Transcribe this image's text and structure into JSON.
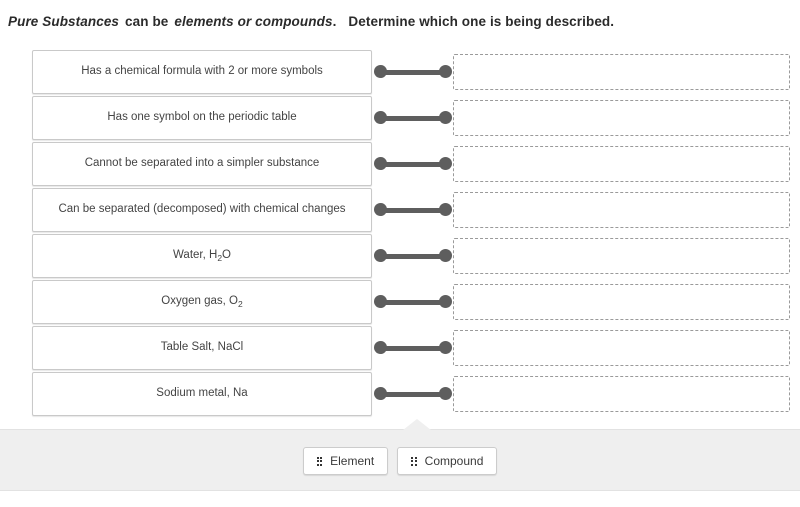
{
  "prompt": {
    "part1": "Pure Substances",
    "part2": "can be",
    "part3": "elements or compounds",
    "part4": ".",
    "part5": "Determine which one is being described."
  },
  "match": {
    "rows": [
      {
        "term": "Has a chemical formula with 2 or more symbols",
        "answer": ""
      },
      {
        "term": "Has one symbol on the periodic table",
        "answer": ""
      },
      {
        "term": "Cannot be separated into a simpler substance",
        "answer": ""
      },
      {
        "term": "Can be separated (decomposed) with chemical changes",
        "answer": ""
      },
      {
        "term": "Water, H2O",
        "answer": ""
      },
      {
        "term": "Oxygen gas, O2",
        "answer": ""
      },
      {
        "term": "Table Salt, NaCl",
        "answer": ""
      },
      {
        "term": "Sodium metal, Na",
        "answer": ""
      }
    ]
  },
  "tray": {
    "tiles": [
      {
        "label": "Element",
        "icon": "grip-dots-icon"
      },
      {
        "label": "Compound",
        "icon": "grip-dots-icon"
      }
    ]
  },
  "colors": {
    "connector": "#5e5e5e",
    "tray_background": "#efefef",
    "box_border": "#c9c9c9",
    "dropzone_border": "#9a9a9a",
    "text": "#444444"
  }
}
